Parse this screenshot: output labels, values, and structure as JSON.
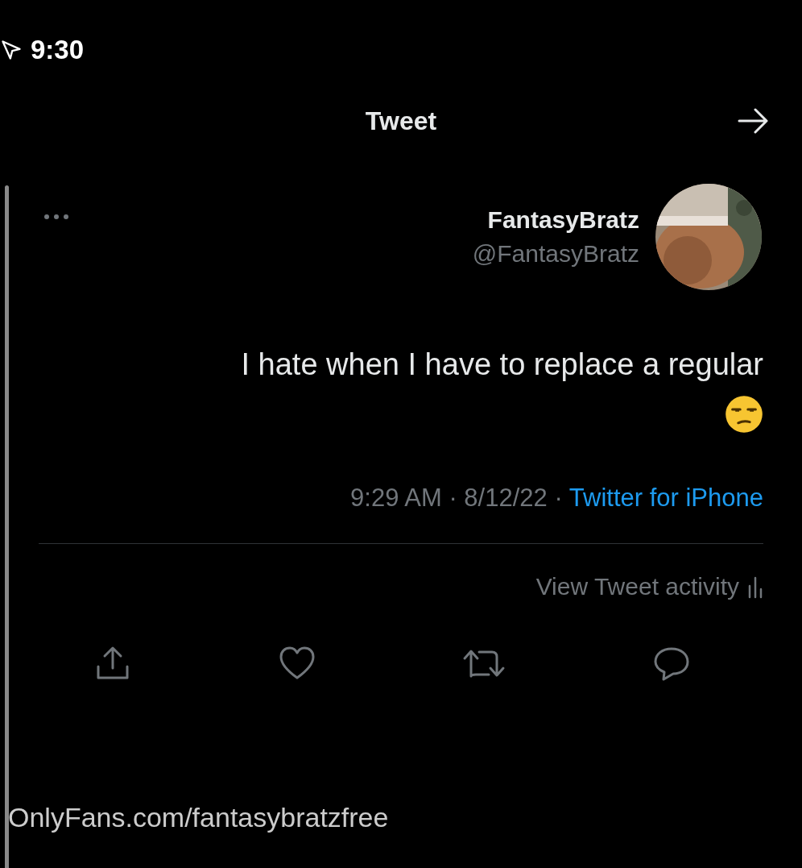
{
  "status_bar": {
    "time": "9:30"
  },
  "header": {
    "title": "Tweet"
  },
  "tweet": {
    "author": {
      "name": "FantasyBratz",
      "handle": "@FantasyBratz"
    },
    "text": "I hate when I have to replace a regular",
    "meta": "9:29 AM · 8/12/22 · ",
    "source": "Twitter for iPhone",
    "activity": "View Tweet activity"
  },
  "caption": "OnlyFans.com/fantasybratzfree"
}
